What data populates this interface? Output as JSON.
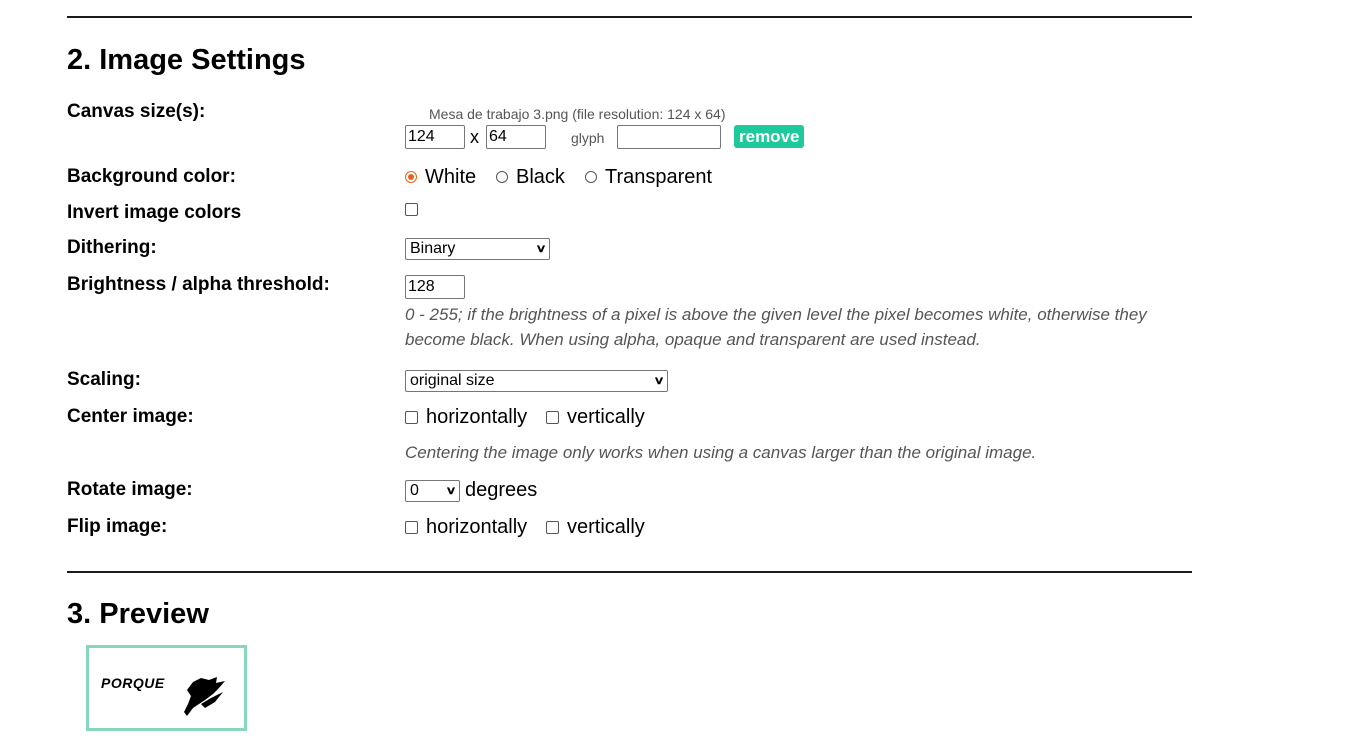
{
  "section2": {
    "title": "2. Image Settings",
    "canvas": {
      "label": "Canvas size(s):",
      "file_info": "Mesa de trabajo 3.png (file resolution: 124 x 64)",
      "width": "124",
      "separator": "x",
      "height": "64",
      "glyph_label": "glyph",
      "glyph_value": "",
      "remove_label": "remove"
    },
    "background": {
      "label": "Background color:",
      "options": [
        "White",
        "Black",
        "Transparent"
      ],
      "selected": "White"
    },
    "invert": {
      "label": "Invert image colors",
      "checked": false
    },
    "dithering": {
      "label": "Dithering:",
      "value": "Binary"
    },
    "threshold": {
      "label": "Brightness / alpha threshold:",
      "value": "128",
      "note_line1": "0 - 255; if the brightness of a pixel is above the given level the pixel becomes white, otherwise they",
      "note_line2": "become black. When using alpha, opaque and transparent are used instead."
    },
    "scaling": {
      "label": "Scaling:",
      "value": "original size"
    },
    "center": {
      "label": "Center image:",
      "horizontal": "horizontally",
      "vertical": "vertically",
      "note": "Centering the image only works when using a canvas larger than the original image."
    },
    "rotate": {
      "label": "Rotate image:",
      "value": "0",
      "unit": "degrees"
    },
    "flip": {
      "label": "Flip image:",
      "horizontal": "horizontally",
      "vertical": "vertically"
    }
  },
  "section3": {
    "title": "3. Preview",
    "preview_text": "PORQUE"
  },
  "colors": {
    "accent": "#1ec99b",
    "radio_selected": "#e8611a",
    "preview_border": "#87d7c0"
  }
}
